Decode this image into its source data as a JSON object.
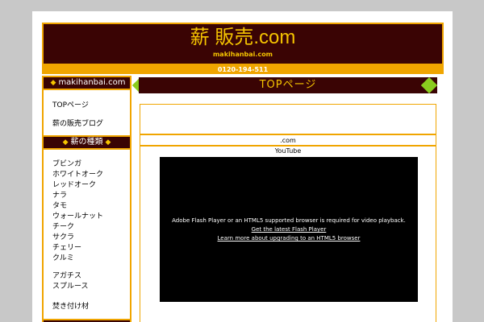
{
  "header": {
    "site_title": "薪 販売.com",
    "site_subtitle": "makihanbai.com",
    "phone": "0120-194-511"
  },
  "sidebar": {
    "brand_label": "makihanbai.com",
    "nav_links": [
      "TOPページ",
      "薪の販売ブログ"
    ],
    "types_heading": "薪の種類",
    "wood_types": [
      "ブビンガ",
      "ホワイトオーク",
      "レッドオーク",
      "ナラ",
      "タモ",
      "ウォールナット",
      "チーク",
      "サクラ",
      "チェリー",
      "クルミ"
    ],
    "softwood_types": [
      "アガチス",
      "スプルース"
    ],
    "kindling": "焚き付け材"
  },
  "main": {
    "title": "TOPページ",
    "dotcom_label": ".com",
    "video_label": "YouTube",
    "video_message": "Adobe Flash Player or an HTML5 supported browser is required for video playback.",
    "video_link_1": "Get the latest Flash Player",
    "video_link_2": "Learn more about upgrading to an HTML5 browser"
  },
  "colors": {
    "background": "#c8c8c8",
    "header_bg": "#3a0404",
    "accent_orange": "#f0a500",
    "title_yellow": "#f5c400",
    "gem_green": "#8acd1e"
  }
}
